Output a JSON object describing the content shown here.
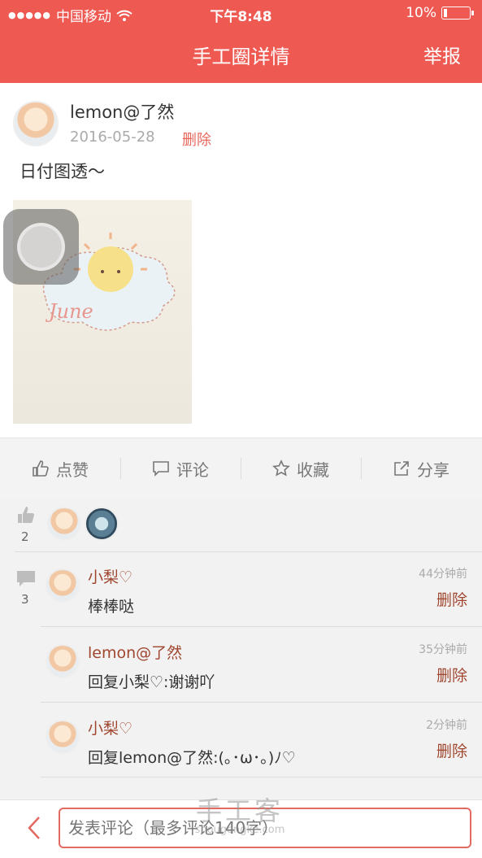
{
  "status_bar": {
    "carrier": "中国移动",
    "time": "下午8:48",
    "battery": "10%"
  },
  "header": {
    "title": "手工圈详情",
    "report": "举报"
  },
  "post": {
    "author": "lemon@了然",
    "date": "2016-05-28",
    "delete": "删除",
    "text": "日付图透～"
  },
  "actions": [
    {
      "label": "点赞",
      "icon": "thumbs-up-icon"
    },
    {
      "label": "评论",
      "icon": "comment-icon"
    },
    {
      "label": "收藏",
      "icon": "star-icon"
    },
    {
      "label": "分享",
      "icon": "share-icon"
    }
  ],
  "likes": {
    "count": "2"
  },
  "comments": {
    "count": "3",
    "items": [
      {
        "name": "小梨♡",
        "text": "棒棒哒",
        "time": "44分钟前",
        "delete": "删除"
      },
      {
        "name": "lemon@了然",
        "text": "回复小梨♡:谢谢吖",
        "time": "35分钟前",
        "delete": "删除"
      },
      {
        "name": "小梨♡",
        "text": "回复lemon@了然:(｡･ω･｡)ﾉ♡",
        "time": "2分钟前",
        "delete": "删除"
      }
    ]
  },
  "input": {
    "placeholder": "发表评论（最多评论140字）"
  },
  "watermark": {
    "main": "手工客",
    "sub": "shougongke.com"
  },
  "colors": {
    "brand": "#ee5a52",
    "name": "#a0462f"
  }
}
